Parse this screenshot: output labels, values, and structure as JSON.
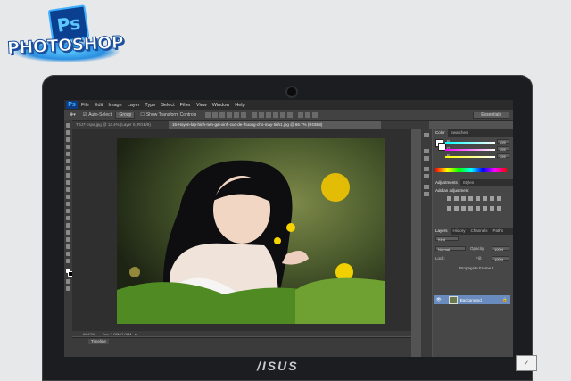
{
  "logo": {
    "badge": "Ps",
    "wordmark": "PHOTOSHOP"
  },
  "laptop": {
    "brand": "/ISUS",
    "sticker": "✓"
  },
  "app": {
    "logo": "Ps",
    "menu": [
      "File",
      "Edit",
      "Image",
      "Layer",
      "Type",
      "Select",
      "Filter",
      "View",
      "Window",
      "Help"
    ],
    "options": {
      "tool_icon": "move-tool-icon",
      "auto_select": "Auto-Select:",
      "group": "Group",
      "transform": "Show Transform Controls",
      "workspace": "Essentials"
    },
    "tabs": [
      {
        "label": "TBJ7-cspa.jpg @ 13.4% (Layer 0, RGB/8)",
        "active": false
      },
      {
        "label": "15-Hoyen-lap-hinh-nen-gai-xinh-cuc-de-thuong-cho-may-tinh1.jpg @ 66.7% (RGB/8)",
        "active": true
      }
    ],
    "status": {
      "zoom": "66.67%",
      "doc": "Doc: 2.08M/2.08M"
    },
    "timeline_label": "Timeline",
    "panels": {
      "color_tabs": [
        "Color",
        "Swatches"
      ],
      "rgb": [
        {
          "ch": "R",
          "val": "255"
        },
        {
          "ch": "G",
          "val": "255"
        },
        {
          "ch": "B",
          "val": "255"
        }
      ],
      "adj_tabs": [
        "Adjustments",
        "Styles"
      ],
      "adj_title": "Add an adjustment",
      "layer_tabs": [
        "Layers",
        "History",
        "Channels",
        "Paths"
      ],
      "kind": "Kind",
      "blend": "Normal",
      "opacity_label": "Opacity:",
      "opacity": "100%",
      "lock_label": "Lock:",
      "fill_label": "Fill:",
      "fill": "100%",
      "propagate": "Propagate Frame 1",
      "layer_name": "Background"
    }
  },
  "colors": {
    "accent": "#6a8bbd",
    "ui_dark": "#3b3b3b",
    "ui_panel": "#474747"
  }
}
